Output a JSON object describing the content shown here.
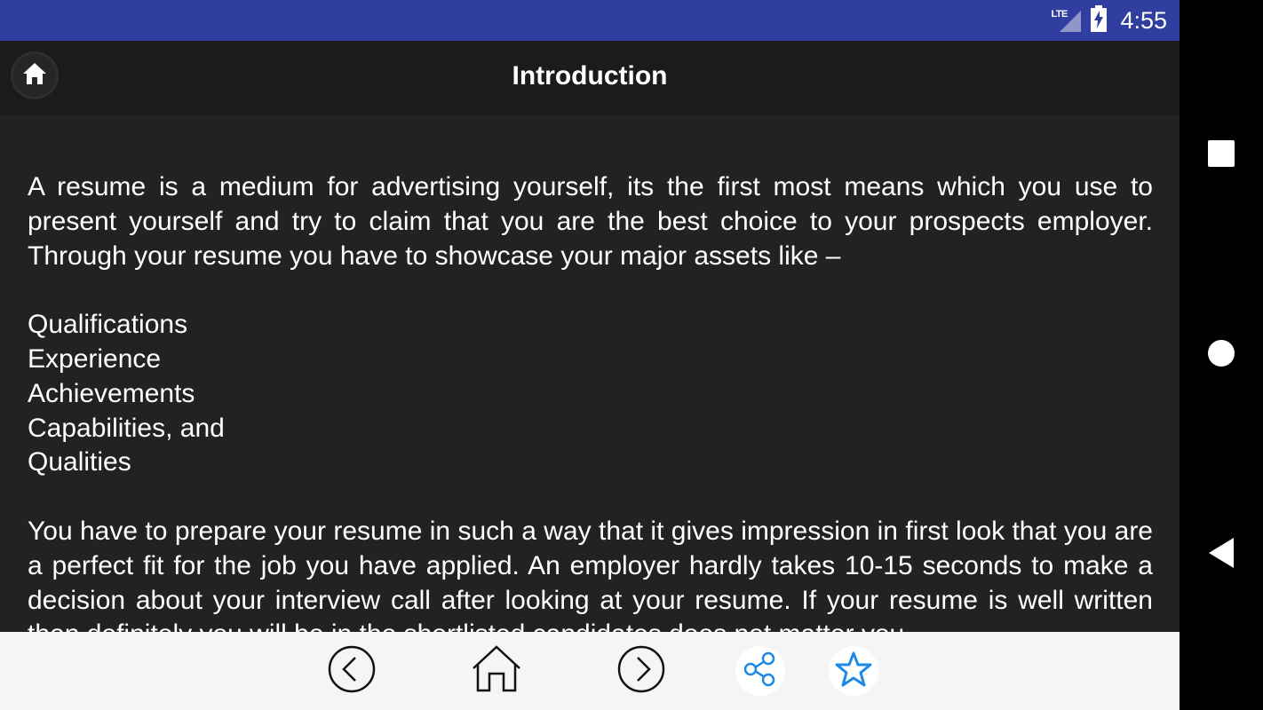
{
  "status_bar": {
    "network_label": "LTE",
    "time": "4:55",
    "icons": [
      "lte-signal-icon",
      "battery-charging-icon"
    ]
  },
  "app_bar": {
    "title": "Introduction",
    "home_icon": "home-icon"
  },
  "content": {
    "paragraph_1": "A resume is a medium for advertising yourself, its the first most means which you use to present yourself and try to claim that you are the best choice to your prospects employer. Through your resume you have to showcase your major assets like –",
    "list_items": [
      "Qualifications",
      "Experience",
      "Achievements",
      "Capabilities, and",
      "Qualities"
    ],
    "paragraph_2": "You have to prepare your resume in such a way that it gives impression in first look that you are a perfect fit for the job you have applied. An employer hardly takes 10-15 seconds to make a decision about your interview call after looking at your resume. If your resume is well written then definitely you will be in the shortlisted candidates does not matter you"
  },
  "bottom_bar": {
    "buttons": [
      "previous-icon",
      "home-outline-icon",
      "next-icon",
      "share-icon",
      "favorite-star-icon"
    ],
    "accent_color": "#1e88e5"
  },
  "nav_bar": {
    "buttons": [
      "recents-square-icon",
      "home-circle-icon",
      "back-triangle-icon"
    ]
  }
}
